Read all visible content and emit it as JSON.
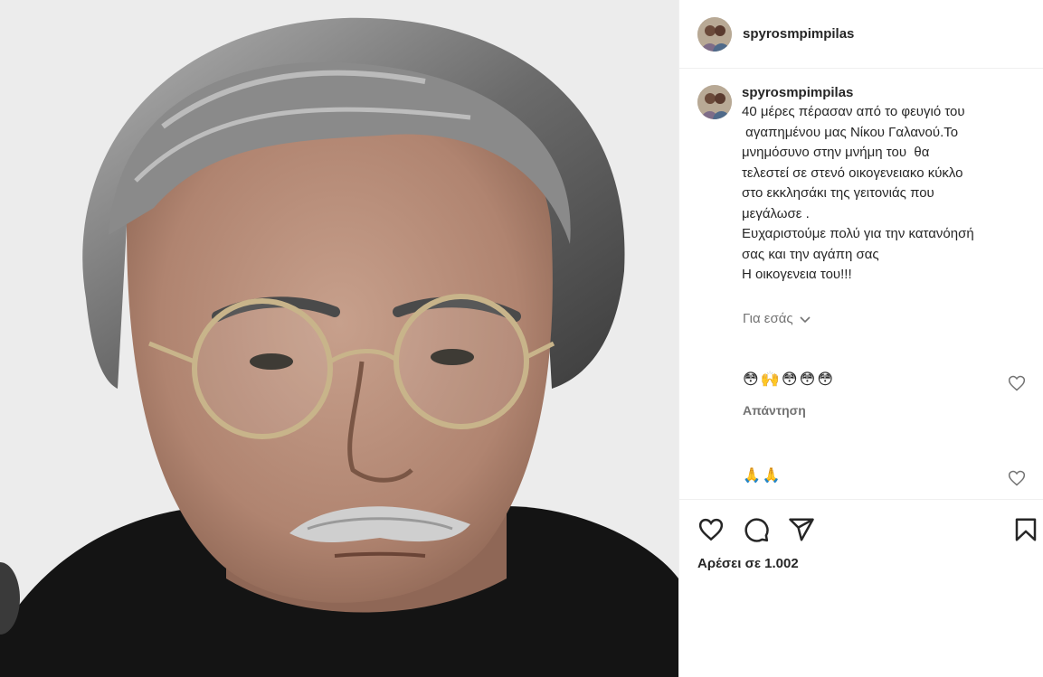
{
  "post": {
    "username": "spyrosmpimpilas",
    "caption_lines": [
      "40 μέρες πέρασαν από το φευγιό του",
      " αγαπημένου μας Νίκου Γαλανού.Το",
      "μνημόσυνο στην μνήμη του  θα",
      "τελεστεί σε στενό οικογενειακο κύκλο",
      "στο εκκλησάκι της γειτονιάς που",
      "μεγάλωσε .",
      "Ευχαριστούμε πολύ για την κατανόησή",
      "σας και την αγάπη σας",
      "Η οικογενεια του!!!"
    ],
    "translate_label": "Για εσάς"
  },
  "comments": [
    {
      "text": "😳🙌😳😳😳",
      "reply_label": "Απάντηση"
    },
    {
      "text": "🙏🙏"
    }
  ],
  "actions": {
    "like_icon": "heart-outline-icon",
    "comment_icon": "speech-bubble-icon",
    "share_icon": "paper-plane-icon",
    "save_icon": "bookmark-icon"
  },
  "likes_label": "Αρέσει σε 1.002",
  "colors": {
    "text": "#262626",
    "secondary": "#737373",
    "divider": "#efefef"
  }
}
